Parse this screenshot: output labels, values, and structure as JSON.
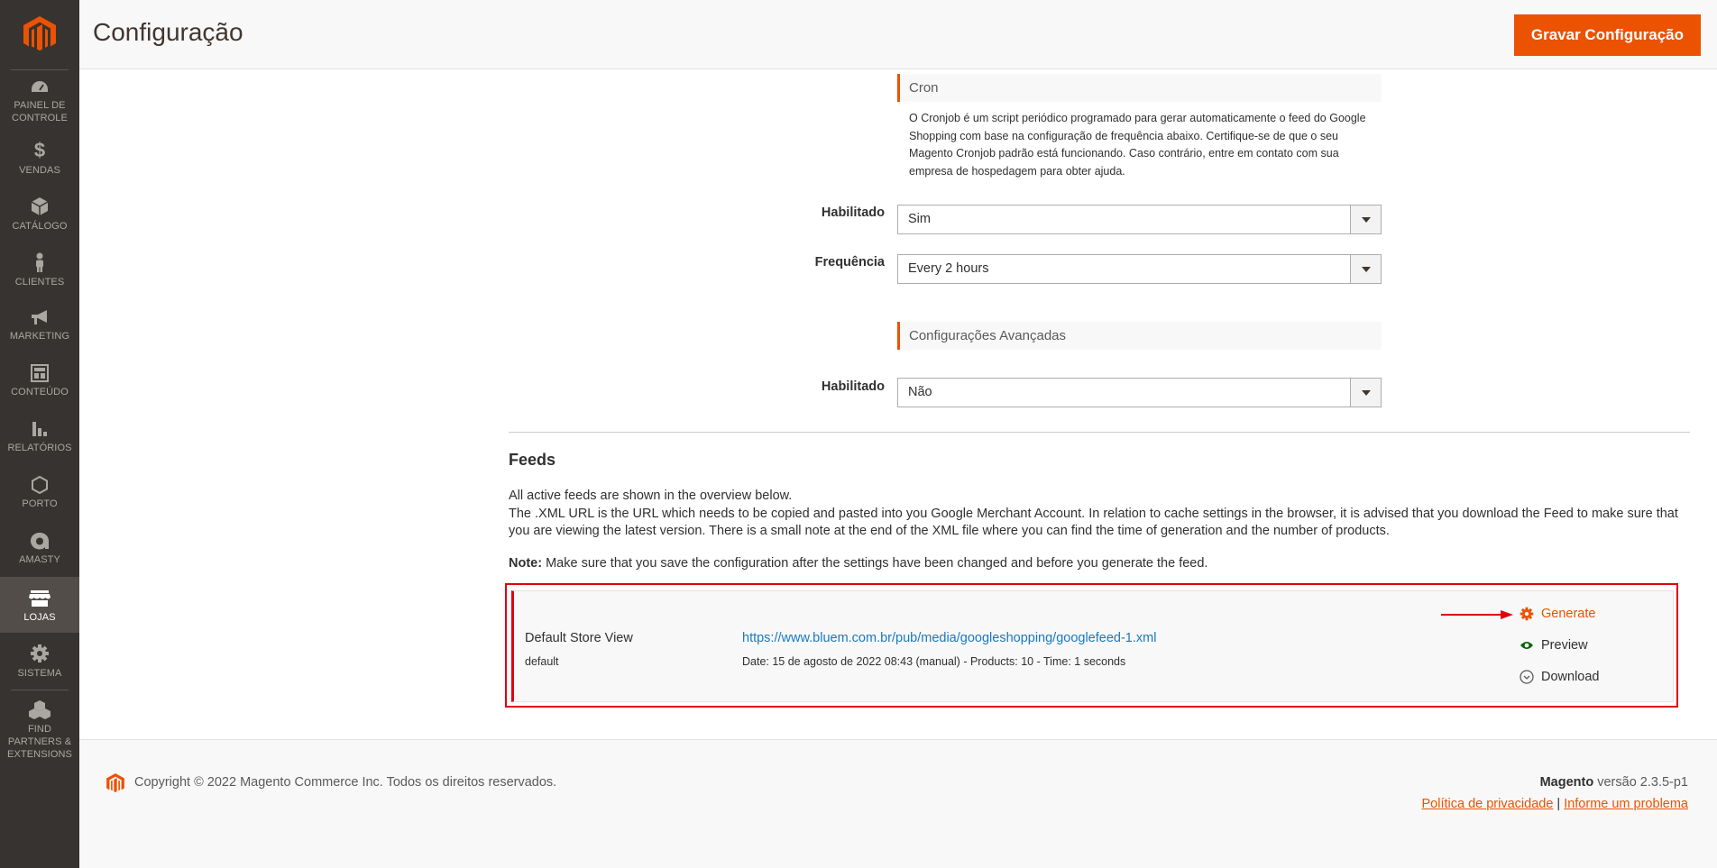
{
  "header": {
    "title": "Configuração",
    "save_button": "Gravar Configuração"
  },
  "sidebar": {
    "items": [
      {
        "label": "PAINEL DE CONTROLE",
        "icon": "dashboard-icon"
      },
      {
        "label": "VENDAS",
        "icon": "dollar-icon"
      },
      {
        "label": "CATÁLOGO",
        "icon": "box-icon"
      },
      {
        "label": "CLIENTES",
        "icon": "person-icon"
      },
      {
        "label": "MARKETING",
        "icon": "megaphone-icon"
      },
      {
        "label": "CONTEÚDO",
        "icon": "layout-icon"
      },
      {
        "label": "RELATÓRIOS",
        "icon": "bar-chart-icon"
      },
      {
        "label": "PORTO",
        "icon": "hexagon-icon"
      },
      {
        "label": "AMASTY",
        "icon": "amasty-icon"
      },
      {
        "label": "LOJAS",
        "icon": "store-icon",
        "active": true
      },
      {
        "label": "SISTEMA",
        "icon": "gear-icon"
      },
      {
        "label": "FIND PARTNERS & EXTENSIONS",
        "icon": "cubes-icon"
      }
    ]
  },
  "cron": {
    "section_title": "Cron",
    "comment": "O Cronjob é um script periódico programado para gerar automaticamente o feed do Google Shopping com base na configuração de frequência abaixo. Certifique-se de que o seu Magento Cronjob padrão está funcionando. Caso contrário, entre em contato com sua empresa de hospedagem para obter ajuda.",
    "enabled_label": "Habilitado",
    "enabled_value": "Sim",
    "frequency_label": "Frequência",
    "frequency_value": "Every 2 hours"
  },
  "advanced": {
    "section_title": "Configurações Avançadas",
    "enabled_label": "Habilitado",
    "enabled_value": "Não"
  },
  "feeds": {
    "title": "Feeds",
    "line1": "All active feeds are shown in the overview below.",
    "line2": "The .XML URL is the URL which needs to be copied and pasted into you Google Merchant Account. In relation to cache settings in the browser, it is advised that you download the Feed to make sure that you are viewing the latest version. There is a small note at the end of the XML file where you can find the time of generation and the number of products.",
    "note_label": "Note:",
    "note_text": " Make sure that you save the configuration after the settings have been changed and before you generate the feed.",
    "rows": [
      {
        "store_name": "Default Store View",
        "store_code": "default",
        "url": "https://www.bluem.com.br/pub/media/googleshopping/googlefeed-1.xml",
        "meta": "Date: 15 de agosto de 2022 08:43 (manual) - Products: 10 - Time: 1 seconds",
        "actions": {
          "generate": "Generate",
          "preview": "Preview",
          "download": "Download"
        }
      }
    ]
  },
  "footer": {
    "copyright": "Copyright © 2022 Magento Commerce Inc. Todos os direitos reservados.",
    "brand": "Magento",
    "version": " versão 2.3.5-p1",
    "privacy_link": "Política de privacidade",
    "separator": "|",
    "report_link": "Informe um problema"
  },
  "colors": {
    "accent": "#eb5202",
    "sidebar_bg": "#373330",
    "link": "#1979c3",
    "highlight_box": "#e0000f"
  }
}
